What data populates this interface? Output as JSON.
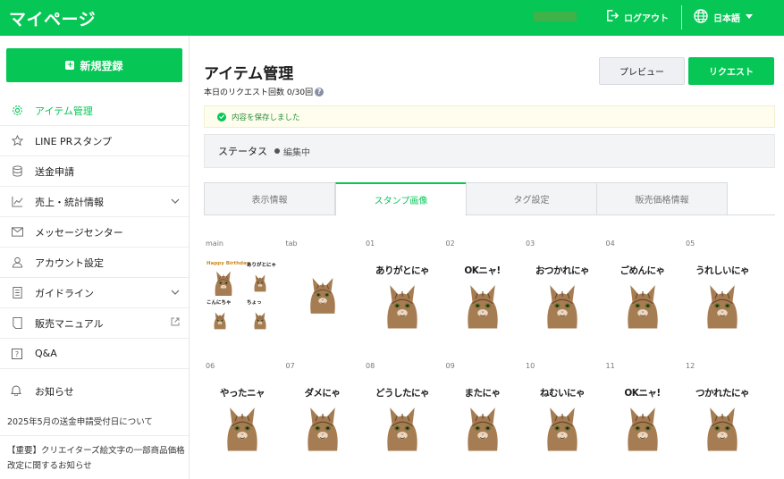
{
  "header": {
    "title": "マイページ",
    "logout_label": "ログアウト",
    "language_label": "日本語"
  },
  "sidebar": {
    "new_button_label": "新規登録",
    "items": [
      {
        "label": "アイテム管理",
        "icon": "gear-icon",
        "active": true
      },
      {
        "label": "LINE PRスタンプ",
        "icon": "star-icon"
      },
      {
        "label": "送金申請",
        "icon": "coins-icon"
      },
      {
        "label": "売上・統計情報",
        "icon": "chart-icon",
        "expandable": true
      },
      {
        "label": "メッセージセンター",
        "icon": "mail-icon"
      },
      {
        "label": "アカウント設定",
        "icon": "person-icon"
      },
      {
        "label": "ガイドライン",
        "icon": "document-icon",
        "expandable": true
      },
      {
        "label": "販売マニュアル",
        "icon": "book-icon",
        "external": true
      },
      {
        "label": "Q&A",
        "icon": "question-icon"
      }
    ],
    "notices_label": "お知らせ",
    "notices": [
      "2025年5月の送金申請受付日について",
      "【重要】クリエイターズ絵文字の一部商品価格改定に関するお知らせ"
    ]
  },
  "main": {
    "title": "アイテム管理",
    "quota_text": "本日のリクエスト回数 0/30回",
    "preview_label": "プレビュー",
    "request_label": "リクエスト",
    "saved_message": "内容を保存しました",
    "status_label": "ステータス",
    "status_value": "編集中",
    "tabs": [
      {
        "label": "表示情報"
      },
      {
        "label": "スタンプ画像",
        "active": true
      },
      {
        "label": "タグ設定"
      },
      {
        "label": "販売価格情報"
      }
    ],
    "stickers": [
      {
        "id": "main",
        "caption": ""
      },
      {
        "id": "tab",
        "caption": ""
      },
      {
        "id": "01",
        "caption": "ありがとにゃ"
      },
      {
        "id": "02",
        "caption": "OKニャ!"
      },
      {
        "id": "03",
        "caption": "おつかれにゃ"
      },
      {
        "id": "04",
        "caption": "ごめんにゃ"
      },
      {
        "id": "05",
        "caption": "うれしいにゃ"
      },
      {
        "id": "06",
        "caption": "やったニャ"
      },
      {
        "id": "07",
        "caption": "ダメにゃ"
      },
      {
        "id": "08",
        "caption": "どうしたにゃ"
      },
      {
        "id": "09",
        "caption": "またにゃ"
      },
      {
        "id": "10",
        "caption": "ねむいにゃ"
      },
      {
        "id": "11",
        "caption": "OKニャ!"
      },
      {
        "id": "12",
        "caption": "つかれたにゃ"
      }
    ],
    "main_preview_captions": [
      "Happy Birthday",
      "ありがとにゃ",
      "こんにちゃ",
      "ちょっ"
    ]
  },
  "colors": {
    "brand": "#06c755",
    "cat_fur": "#a67c52"
  }
}
